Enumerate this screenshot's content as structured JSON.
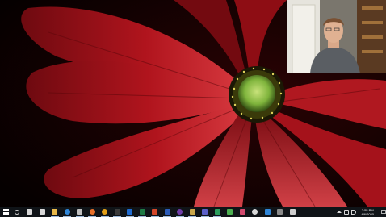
{
  "taskbar": {
    "start_icon": "windows-logo-icon",
    "apps": [
      {
        "name": "search-icon",
        "color": "#d8d8d8"
      },
      {
        "name": "task-view-icon",
        "color": "#d8d8d8"
      },
      {
        "name": "widgets-icon",
        "color": "#d8d8d8"
      },
      {
        "name": "file-explorer-icon",
        "color": "#e8b84a"
      },
      {
        "name": "edge-browser-icon",
        "color": "#2f86d8"
      },
      {
        "name": "settings-gear-icon",
        "color": "#bfbfbf"
      },
      {
        "name": "firefox-icon",
        "color": "#e8702a"
      },
      {
        "name": "chrome-icon",
        "color": "#e4a019"
      },
      {
        "name": "terminal-icon",
        "color": "#3a3a3a"
      },
      {
        "name": "outlook-icon",
        "color": "#1f6bd1"
      },
      {
        "name": "excel-icon",
        "color": "#1e7a44"
      },
      {
        "name": "powerpoint-icon",
        "color": "#d2472a"
      },
      {
        "name": "word-icon",
        "color": "#2b5bb8"
      },
      {
        "name": "obs-record-icon",
        "color": "#6f3da8"
      },
      {
        "name": "photos-icon",
        "color": "#c9a64a"
      },
      {
        "name": "teams-icon",
        "color": "#5b5fc7"
      },
      {
        "name": "maps-icon",
        "color": "#2a9d5c"
      },
      {
        "name": "notes-icon",
        "color": "#4caf50"
      },
      {
        "name": "media-player-icon",
        "color": "#d24a6e"
      },
      {
        "name": "clock-app-icon",
        "color": "#d8d8d8"
      },
      {
        "name": "onedrive-icon",
        "color": "#2f86d8"
      },
      {
        "name": "calculator-icon",
        "color": "#8a8a8a"
      },
      {
        "name": "shortcut-icon",
        "color": "#cfcfcf"
      }
    ],
    "tray_icons": [
      {
        "name": "chevron-up-icon",
        "color": "#d8d8d8"
      },
      {
        "name": "network-icon",
        "color": "#d8d8d8"
      },
      {
        "name": "volume-icon",
        "color": "#d8d8d8"
      }
    ],
    "time": "2:55 PM",
    "date": "4/6/2020",
    "notification_icon": "notification-icon"
  },
  "colors": {
    "taskbar_bg": "#101418",
    "petal_red": "#b3141e",
    "flower_center": "#8fc64a"
  }
}
